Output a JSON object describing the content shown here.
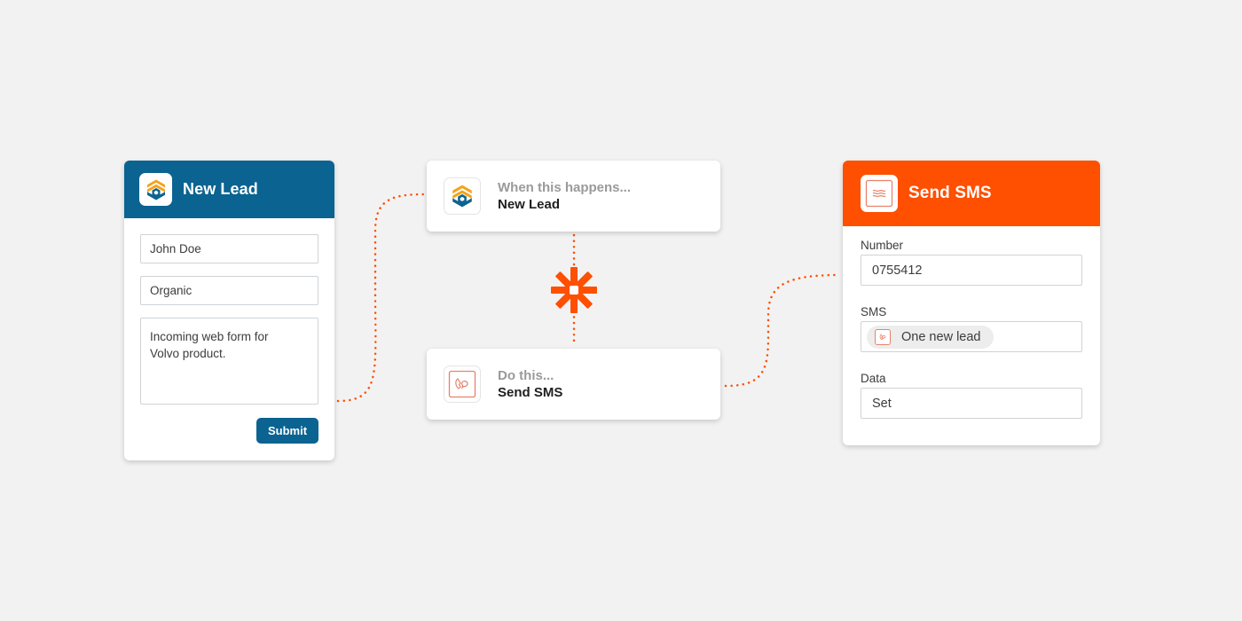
{
  "colors": {
    "background": "#f2f2f2",
    "lead_brand": "#0b6391",
    "accent": "#ff4f00",
    "hex_orange": "#f5a31b",
    "hex_blue": "#0b6391"
  },
  "lead_form": {
    "app_icon": "hexagon-logo-icon",
    "title": "New Lead",
    "fields": {
      "name_value": "John Doe",
      "source_value": "Organic",
      "message_value": "Incoming web form for\nVolvo product."
    },
    "submit_label": "Submit"
  },
  "zap": {
    "trigger": {
      "icon": "hexagon-logo-icon",
      "label": "When this happens...",
      "name": "New Lead"
    },
    "connector_icon": "zapier-asterisk-icon",
    "action": {
      "icon": "sms-icon",
      "label": "Do this...",
      "name": "Send SMS"
    }
  },
  "sms_card": {
    "app_icon": "sms-icon",
    "title": "Send SMS",
    "number": {
      "label": "Number",
      "value": "0755412"
    },
    "sms": {
      "label": "SMS",
      "chip_icon": "sms-icon",
      "chip_text": "One new lead"
    },
    "data": {
      "label": "Data",
      "value": "Set"
    }
  }
}
